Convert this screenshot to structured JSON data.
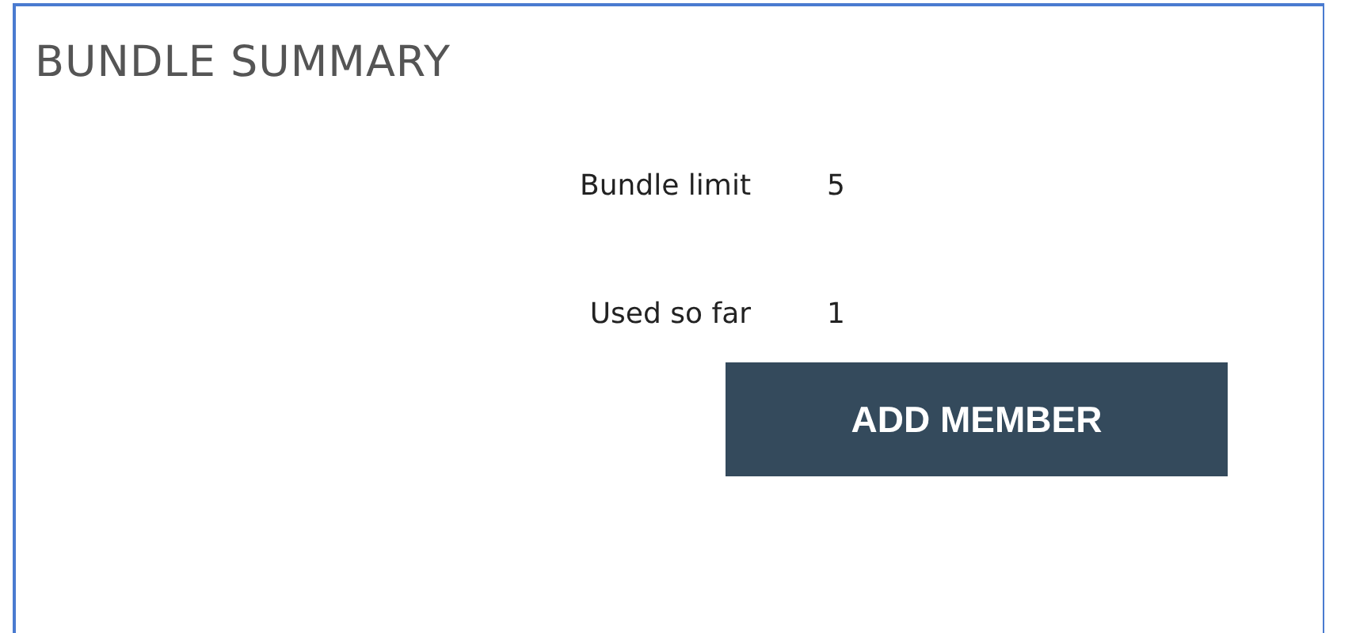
{
  "panel": {
    "title": "BUNDLE SUMMARY"
  },
  "rows": [
    {
      "label": "Bundle limit",
      "value": "5"
    },
    {
      "label": "Used so far",
      "value": "1"
    }
  ],
  "button": {
    "label": "ADD MEMBER"
  }
}
